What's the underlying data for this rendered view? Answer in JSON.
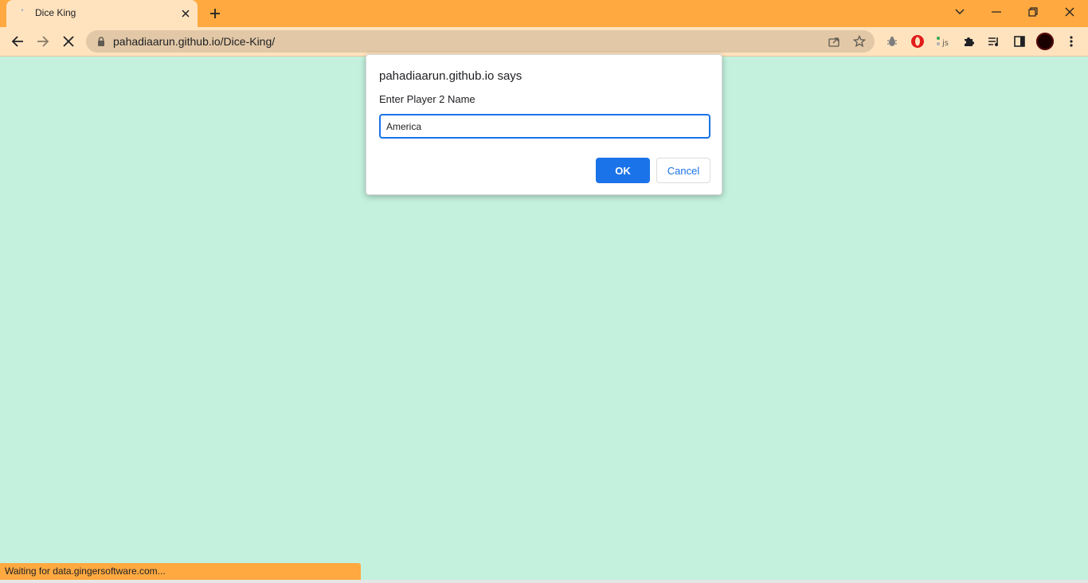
{
  "tab": {
    "title": "Dice King",
    "favicon": "loading-indicator-icon"
  },
  "address_bar": {
    "url": "pahadiaarun.github.io/Dice-King/"
  },
  "dialog": {
    "title": "pahadiaarun.github.io says",
    "message": "Enter Player 2 Name",
    "input_value": "America",
    "ok_label": "OK",
    "cancel_label": "Cancel"
  },
  "status_bar": {
    "text": "Waiting for data.gingersoftware.com..."
  },
  "colors": {
    "tabstrip": "#ffa940",
    "toolbar": "#ffe3bf",
    "page_background": "#c3f1de",
    "accent": "#1a73e8"
  },
  "icons": {
    "back": "arrow-left-icon",
    "forward": "arrow-right-icon",
    "stop": "stop-icon",
    "lock": "lock-icon",
    "share": "share-icon",
    "bookmark": "star-icon",
    "extensions": [
      "bug-extension-icon",
      "opera-extension-icon",
      "js-extension-icon",
      "puzzle-icon",
      "reading-list-icon",
      "side-panel-icon"
    ],
    "menu": "kebab-menu-icon"
  }
}
